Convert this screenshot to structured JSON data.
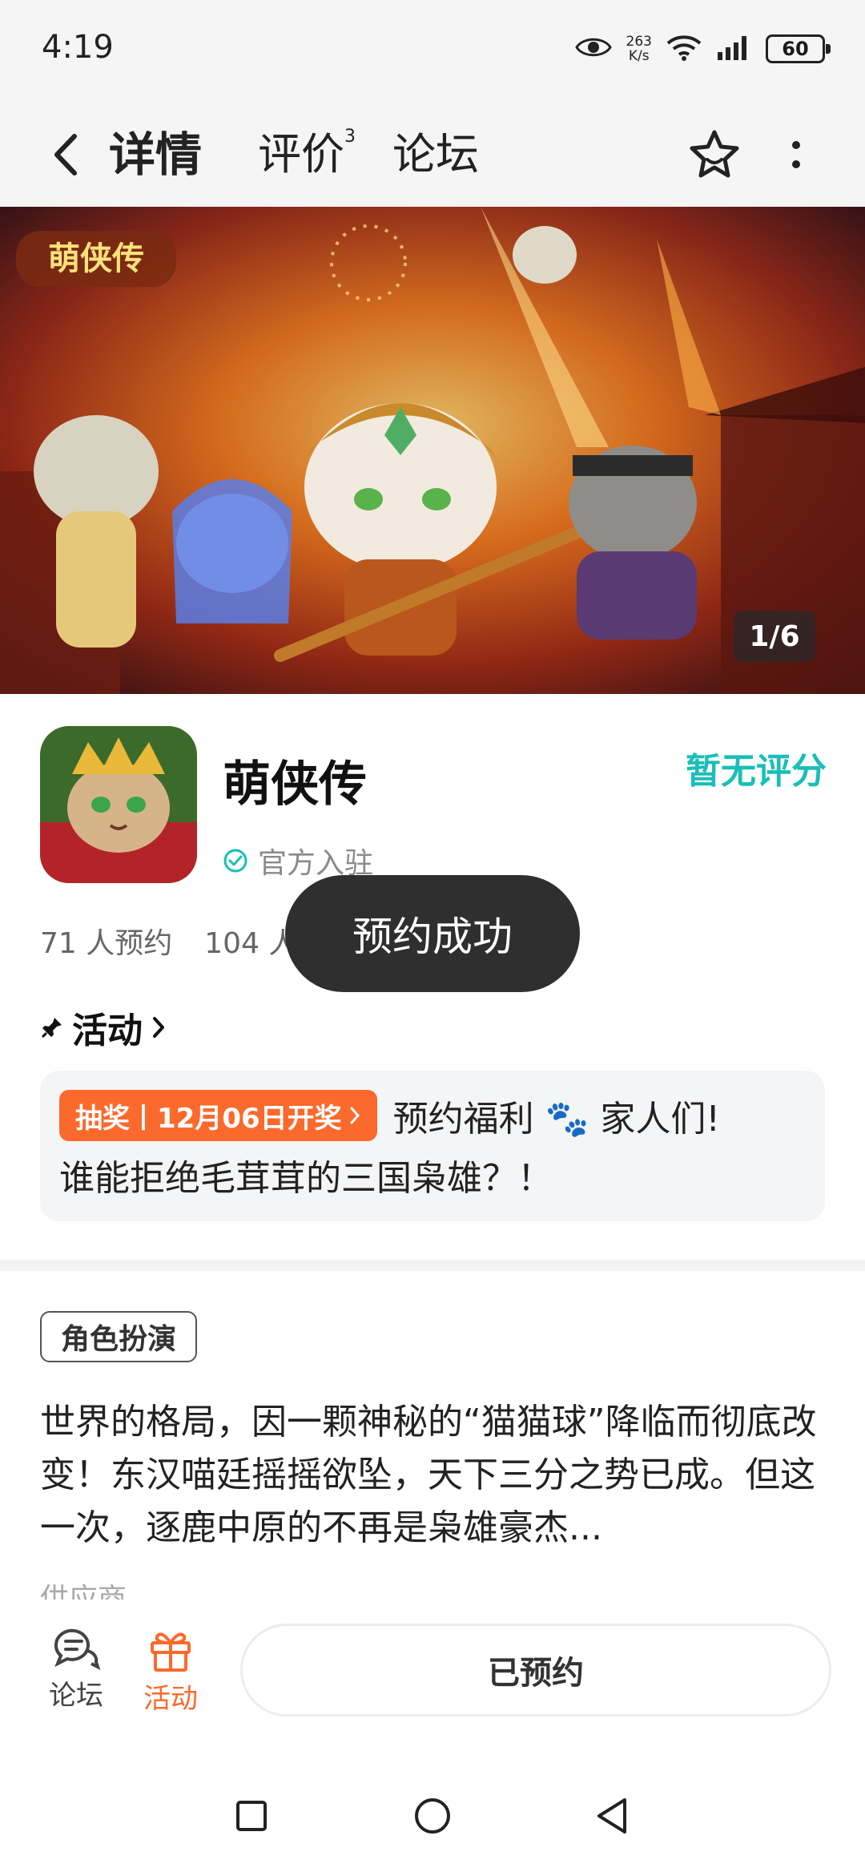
{
  "status_bar": {
    "time": "4:19",
    "net_speed_value": "263",
    "net_speed_unit": "K/s",
    "battery": "60"
  },
  "nav": {
    "tabs": [
      {
        "label": "详情",
        "active": true
      },
      {
        "label": "评价",
        "badge": "3"
      },
      {
        "label": "论坛"
      }
    ]
  },
  "banner": {
    "logo_text": "萌侠传",
    "counter": "1/6"
  },
  "app": {
    "name": "萌侠传",
    "verified_label": "官方入驻",
    "rating_text": "暂无评分",
    "reservations": "71 人预约",
    "other_stat": "104 人"
  },
  "toast": {
    "message": "预约成功"
  },
  "activity": {
    "header": "活动",
    "badge": "抽奖丨12月06日开奖",
    "line1_text": "预约福利 🐾 家人们!",
    "line2_text": "谁能拒绝毛茸茸的三国枭雄？！"
  },
  "genre_tag": "角色扮演",
  "description": "世界的格局，因一颗神秘的“猫猫球”降临而彻底改变！东汉喵廷摇摇欲坠，天下三分之势已成。但这一次，逐鹿中原的不再是枭雄豪杰...",
  "meta_partial": "供应商",
  "bottom_bar": {
    "forum_label": "论坛",
    "activity_label": "活动",
    "reserved_label": "已预约"
  },
  "colors": {
    "accent_teal": "#19bfb8",
    "accent_orange": "#fb6a2c",
    "toast_bg": "#2f2f2f"
  }
}
